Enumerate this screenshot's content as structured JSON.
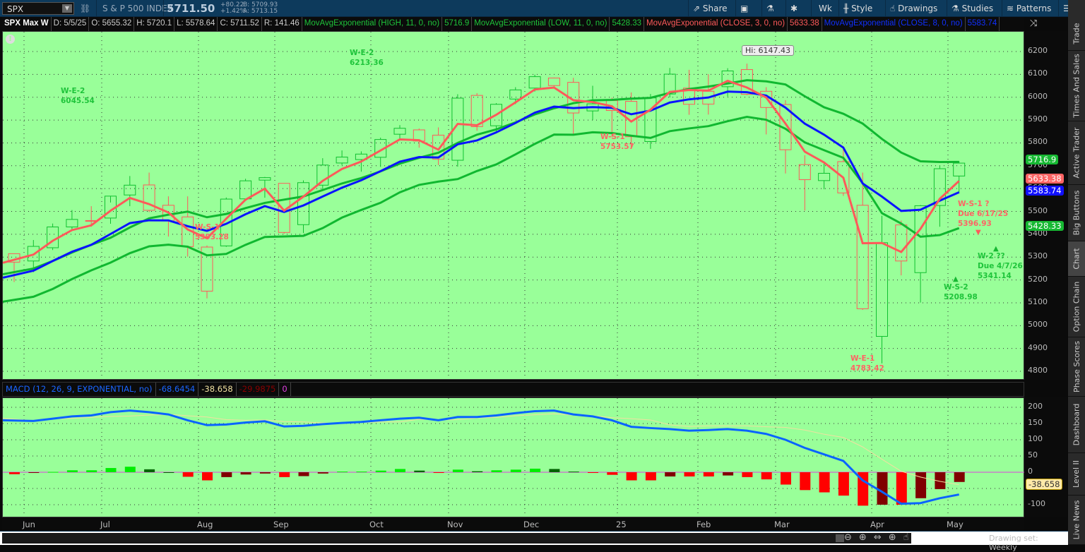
{
  "toolbar": {
    "symbol": "SPX",
    "description": "S & P 500 INDEX",
    "last": "5711.50",
    "change": "+80.22",
    "change_pct": "+1.42%",
    "bid": "B: 5709.93",
    "ask": "A: 5713.15",
    "buttons": {
      "share": "Share",
      "timeframe": "Wk",
      "style": "Style",
      "drawings": "Drawings",
      "studies": "Studies",
      "patterns": "Patterns"
    }
  },
  "infobar": {
    "title": "SPX Max W",
    "date": "D: 5/5/25",
    "open": "O: 5655.32",
    "high": "H: 5720.1",
    "low": "L: 5578.64",
    "close": "C: 5711.52",
    "range": "R: 141.46",
    "studies": [
      {
        "label": "MovAvgExponential (HIGH, 11, 0, no)",
        "value": "5716.9",
        "color": "#1ec43a"
      },
      {
        "label": "MovAvgExponential (LOW, 11, 0, no)",
        "value": "5428.33",
        "color": "#1ec43a"
      },
      {
        "label": "MovAvgExponential (CLOSE, 3, 0, no)",
        "value": "5633.38",
        "color": "#ff5a5a"
      },
      {
        "label": "MovAvgExponential (CLOSE, 8, 0, no)",
        "value": "5583.74",
        "color": "#1030ff"
      }
    ]
  },
  "price_tags": [
    {
      "value": "5716.9",
      "color": "#16b832"
    },
    {
      "value": "5633.38",
      "color": "#ff6464"
    },
    {
      "value": "5583.74",
      "color": "#1010ff"
    },
    {
      "value": "5428.33",
      "color": "#16b832"
    }
  ],
  "annotations": {
    "hi": "Hi: 6147.43",
    "we2a": "W-E-2\n6045.54",
    "we2b": "W-E-2\n6213.36",
    "ws1a": "W-S-1\n5393.28",
    "ws1b": "W-S-1\n5753.57",
    "we1": "W-E-1\n4783.42",
    "ws1q": "W-S-1 ?\nDue 6/17/25\n5396.93",
    "w2q": "W-2 ??\nDue 4/7/26\n5341.14",
    "ws2": "W-S-2\n5208.98"
  },
  "macd_header": {
    "label": "MACD (12, 26, 9, EXPONENTIAL, no)",
    "value": "-68.6454",
    "avg": "-38.658",
    "diff": "-29.9875",
    "zero": "0"
  },
  "macd_tag": "-38.658",
  "sidebar": [
    "Trade",
    "Times And Sales",
    "Active Trader",
    "Big Buttons",
    "Chart",
    "Option Chain",
    "Phase Scores",
    "Dashboard",
    "Level II",
    "Live News"
  ],
  "bottom": {
    "drawing_set": "Drawing set: Weekly"
  },
  "chart_data": {
    "type": "candlestick",
    "ylim": [
      4750,
      6250
    ],
    "yticks": [
      4800,
      4900,
      5000,
      5100,
      5200,
      5300,
      5400,
      5500,
      5600,
      5700,
      5800,
      5900,
      6000,
      6100,
      6200
    ],
    "xlabels": [
      "Jun",
      "Jul",
      "Aug",
      "Sep",
      "Oct",
      "Nov",
      "Dec",
      "25",
      "Feb",
      "Mar",
      "Apr",
      "May"
    ],
    "ohlc": [
      [
        5315,
        5315,
        5191,
        5278
      ],
      [
        5283,
        5375,
        5234,
        5347
      ],
      [
        5341,
        5447,
        5331,
        5432
      ],
      [
        5432,
        5506,
        5420,
        5465
      ],
      [
        5460,
        5523,
        5433,
        5460
      ],
      [
        5471,
        5539,
        5446,
        5567
      ],
      [
        5572,
        5655,
        5523,
        5615
      ],
      [
        5616,
        5670,
        5497,
        5505
      ],
      [
        5527,
        5566,
        5390,
        5459
      ],
      [
        5476,
        5566,
        5302,
        5346
      ],
      [
        5151,
        5351,
        5119,
        5344
      ],
      [
        5349,
        5561,
        5345,
        5554
      ],
      [
        5555,
        5643,
        5553,
        5634
      ],
      [
        5637,
        5651,
        5560,
        5648
      ],
      [
        5623,
        5623,
        5402,
        5408
      ],
      [
        5442,
        5636,
        5406,
        5626
      ],
      [
        5615,
        5733,
        5596,
        5703
      ],
      [
        5712,
        5767,
        5703,
        5738
      ],
      [
        5727,
        5763,
        5674,
        5751
      ],
      [
        5737,
        5823,
        5695,
        5815
      ],
      [
        5838,
        5878,
        5813,
        5864
      ],
      [
        5857,
        5863,
        5779,
        5808
      ],
      [
        5834,
        5868,
        5703,
        5729
      ],
      [
        5724,
        6013,
        5696,
        5996
      ],
      [
        6008,
        6018,
        5853,
        5871
      ],
      [
        5875,
        5974,
        5850,
        5969
      ],
      [
        5992,
        6044,
        5970,
        6032
      ],
      [
        6040,
        6099,
        6025,
        6090
      ],
      [
        6084,
        6086,
        6040,
        6051
      ],
      [
        6065,
        6085,
        5833,
        5931
      ],
      [
        5940,
        6050,
        5900,
        5971
      ],
      [
        5985,
        5998,
        5825,
        5942
      ],
      [
        5982,
        6021,
        5774,
        5827
      ],
      [
        5806,
        6014,
        5774,
        5997
      ],
      [
        6014,
        6128,
        5999,
        6101
      ],
      [
        5969,
        6120,
        5923,
        6040
      ],
      [
        5970,
        6101,
        5924,
        6026
      ],
      [
        6046,
        6127,
        6003,
        6115
      ],
      [
        6121,
        6147,
        6009,
        6013
      ],
      [
        6026,
        6044,
        5837,
        5955
      ],
      [
        5968,
        5987,
        5666,
        5770
      ],
      [
        5705,
        5746,
        5504,
        5639
      ],
      [
        5635,
        5715,
        5597,
        5667
      ],
      [
        5718,
        5786,
        5568,
        5581
      ],
      [
        5527,
        5670,
        5069,
        5074
      ],
      [
        4953,
        5481,
        4835,
        5363
      ],
      [
        5441,
        5460,
        5220,
        5283
      ],
      [
        5232,
        5528,
        5101,
        5525
      ],
      [
        5526,
        5700,
        5433,
        5687
      ],
      [
        5655,
        5720.1,
        5578.64,
        5711.52
      ]
    ],
    "ema_seed": {
      "high11": 5225,
      "low11": 5105,
      "close8": 5210,
      "close3": 5275
    },
    "macd": {
      "ylim": [
        -140,
        230
      ],
      "yticks": [
        200,
        150,
        100,
        50,
        0,
        -50,
        -100
      ],
      "value": [
        160,
        158,
        165,
        172,
        175,
        185,
        190,
        185,
        178,
        160,
        145,
        147,
        153,
        157,
        141,
        143,
        148,
        152,
        155,
        160,
        165,
        168,
        160,
        170,
        170,
        175,
        182,
        188,
        190,
        178,
        172,
        160,
        140,
        136,
        133,
        128,
        130,
        133,
        128,
        118,
        100,
        75,
        55,
        35,
        -25,
        -60,
        -97,
        -95,
        -80,
        -68.65
      ],
      "diff": [
        -6,
        -1,
        1,
        6,
        6,
        13,
        17,
        9,
        0,
        -14,
        -25,
        -15,
        -7,
        -4,
        -15,
        -12,
        -4,
        2,
        2,
        5,
        10,
        5,
        -1,
        8,
        3,
        6,
        8,
        11,
        10,
        2,
        -2,
        -8,
        -25,
        -25,
        -13,
        -13,
        -13,
        -10,
        -15,
        -22,
        -38,
        -55,
        -62,
        -72,
        -103,
        -100,
        -100,
        -80,
        -52,
        -29.99
      ]
    }
  }
}
